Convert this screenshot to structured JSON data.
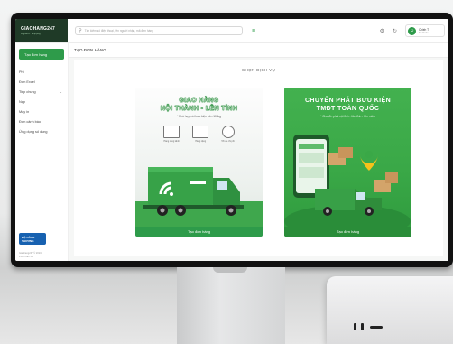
{
  "app": {
    "logo_title": "GIAOHANG247",
    "logo_sub": "Logistics · Shipping"
  },
  "topbar": {
    "search_placeholder": "Tìm kiếm số điện thoại, tên người nhận, mã đơn hàng",
    "user_name": "Chiến T",
    "user_sub": "Tài khoản"
  },
  "sidebar": {
    "create_label": "Tạo đơn hàng",
    "items": [
      {
        "label": "Phí"
      },
      {
        "label": "Đơn Excel"
      },
      {
        "label": "Tiếp chung"
      },
      {
        "label": "Nạp"
      },
      {
        "label": "Máy in"
      },
      {
        "label": "Đơn cảnh báo"
      },
      {
        "label": "Ứng dụng số dung"
      }
    ],
    "badge_label": "BỘ CÔNG THƯƠNG",
    "foot_line1": "Giaohang247 © 2024",
    "foot_line2": "Phiên bản 1.0"
  },
  "page": {
    "title": "TẠO ĐƠN HÀNG",
    "section_title": "CHỌN DỊCH VỤ"
  },
  "services": [
    {
      "title_line1": "GIAO HÀNG",
      "title_line2": "NỘI THÀNH - LÊN TỈNH",
      "subtitle": "* Phù hợp với bưu kiện trên 100kg",
      "features": [
        "Hàng công kềnh",
        "Hàng nặng",
        "Tối ưu chi phí"
      ],
      "button": "Tạo đơn hàng"
    },
    {
      "title_line1": "CHUYỂN PHÁT BƯU KIỆN",
      "title_line2": "TMĐT TOÀN QUỐC",
      "subtitle": "* Chuyển phát nội tỉnh - liên tỉnh - liên miền",
      "button": "Tạo đơn hàng"
    }
  ],
  "colors": {
    "brand_green": "#2e9b4a",
    "brand_dark": "#1f3a27"
  }
}
